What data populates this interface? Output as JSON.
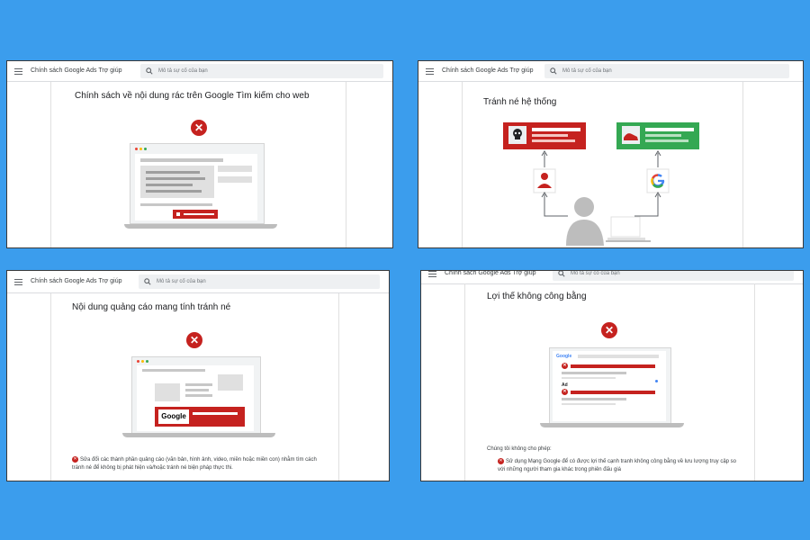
{
  "help_header": {
    "brand": "Chính sách Google Ads Trợ giúp",
    "search_placeholder": "Mô tả sự cố của bạn"
  },
  "panels": [
    {
      "title": "Chính sách về nội dung rác trên Google Tìm kiếm cho web"
    },
    {
      "title": "Tránh né hệ thống"
    },
    {
      "title": "Nội dung quảng cáo mang tính tránh né",
      "logo_text": "Google",
      "bullet": "Sửa đổi các thành phần quảng cáo (văn bản, hình ảnh, video, miền hoặc miền con) nhằm tìm cách tránh né để không bị phát hiện và/hoặc tránh né biện pháp thực thi."
    },
    {
      "title": "Lợi thế không công bằng",
      "mini_logo": "Google",
      "ad_label": "Ad",
      "intro": "Chúng tôi không cho phép:",
      "bullet": "Sử dụng Mạng Google để có được lợi thế cạnh tranh không công bằng về lưu lượng truy cập so với những người tham gia khác trong phiên đấu giá"
    }
  ],
  "colors": {
    "background": "#3b9ded",
    "violation_red": "#c5221f",
    "allowed_green": "#34a853"
  },
  "icons": [
    "menu-icon",
    "search-icon",
    "close-icon",
    "skull-icon",
    "shoe-icon",
    "person-icon",
    "google-g-icon",
    "user-silhouette-icon"
  ]
}
